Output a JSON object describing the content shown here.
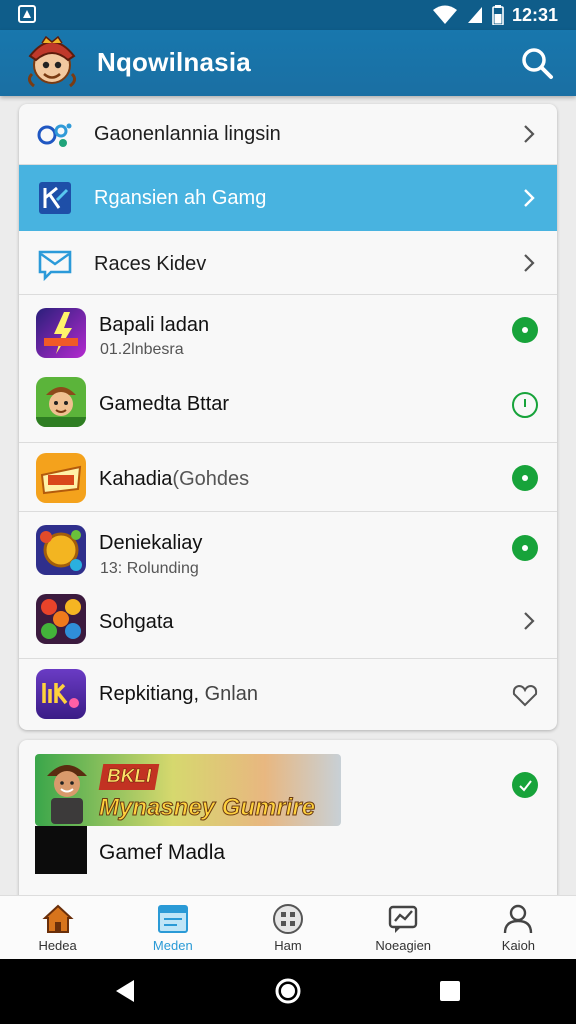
{
  "status_bar": {
    "time": "12:31",
    "icons": [
      "app-notification-icon",
      "wifi-icon",
      "signal-icon",
      "battery-icon"
    ]
  },
  "app_bar": {
    "title": "Nqowilnasia",
    "logo_icon": "mascot-logo-icon",
    "search_icon": "search-icon"
  },
  "menu": [
    {
      "label": "Gaonenlannia lingsin",
      "icon": "categories-icon",
      "trailing": "chevron-right-icon",
      "selected": false
    },
    {
      "label": "Rgansien ah Gamg",
      "icon": "gaming-icon",
      "trailing": "chevron-right-icon",
      "selected": true
    },
    {
      "label": "Races Kidev",
      "icon": "message-icon",
      "trailing": "chevron-right-icon",
      "selected": false
    }
  ],
  "apps": [
    {
      "name": "Bapali ladan",
      "subtitle": "01.2lnbesra",
      "icon": "purple-lightning-game-icon",
      "status": "installed-check-icon"
    },
    {
      "name": "Gamedta Bttar",
      "subtitle": "",
      "icon": "adventure-hero-game-icon",
      "status": "pending-check-icon"
    },
    {
      "name": "Kahadia",
      "name_suffix": "(Gohdes",
      "subtitle": "",
      "icon": "orange-badge-game-icon",
      "status": "installed-check-icon"
    },
    {
      "name": "Deniekaliay",
      "subtitle": "13: Rolunding",
      "icon": "coin-puzzle-game-icon",
      "status": "installed-check-icon"
    },
    {
      "name": "Sohgata",
      "subtitle": "",
      "icon": "gem-match-game-icon",
      "status": "chevron-right-icon"
    },
    {
      "name": "Repkitiang,",
      "name_suffix": "Gnlan",
      "subtitle": "",
      "icon": "purple-logo-game-icon",
      "status": "heart-outline-icon"
    }
  ],
  "featured": {
    "banner_tag": "BKLI",
    "banner_title": "Mynasney Gumrire",
    "label": "Gamef Madla",
    "status": "installed-check-icon"
  },
  "bottom_nav": [
    {
      "label": "Hedea",
      "icon": "home-icon",
      "active": false
    },
    {
      "label": "Meden",
      "icon": "media-icon",
      "active": true
    },
    {
      "label": "Ham",
      "icon": "apps-grid-icon",
      "active": false
    },
    {
      "label": "Noeagien",
      "icon": "chat-icon",
      "active": false
    },
    {
      "label": "Kaioh",
      "icon": "profile-icon",
      "active": false
    }
  ],
  "colors": {
    "app_bar": "#1a6fa3",
    "selected_row": "#48b3e0",
    "status_green": "#17a33a",
    "active_nav": "#2a9ad6"
  }
}
